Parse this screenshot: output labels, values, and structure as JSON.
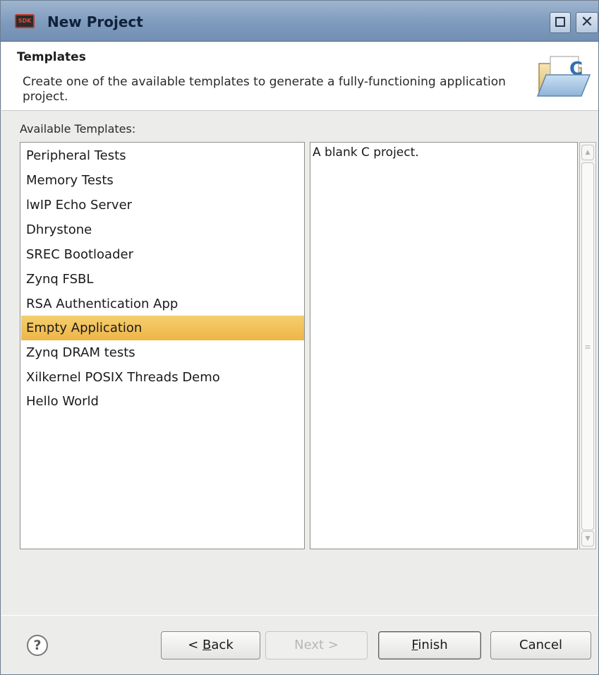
{
  "window": {
    "title": "New Project",
    "app_icon_text": "SDK",
    "maximize_icon": "maximize-icon",
    "close_glyph": "✕"
  },
  "header": {
    "title": "Templates",
    "description": "Create one of the available templates to generate a fully-functioning application project.",
    "icon": "folder-c-icon"
  },
  "templates": {
    "label": "Available Templates:",
    "items": [
      "Peripheral Tests",
      "Memory Tests",
      "lwIP Echo Server",
      "Dhrystone",
      "SREC Bootloader",
      "Zynq FSBL",
      "RSA Authentication App",
      "Empty Application",
      "Zynq DRAM tests",
      "Xilkernel POSIX Threads Demo",
      "Hello World"
    ],
    "selected": "Empty Application",
    "selection_color": "#f2c25a"
  },
  "description_panel": {
    "text": "A blank C project."
  },
  "footer": {
    "help_glyph": "?",
    "back": {
      "prefix": "< ",
      "mnemonic": "B",
      "rest": "ack"
    },
    "next": {
      "label": "Next >"
    },
    "finish": {
      "mnemonic": "F",
      "rest": "inish"
    },
    "cancel": {
      "label": "Cancel"
    }
  }
}
